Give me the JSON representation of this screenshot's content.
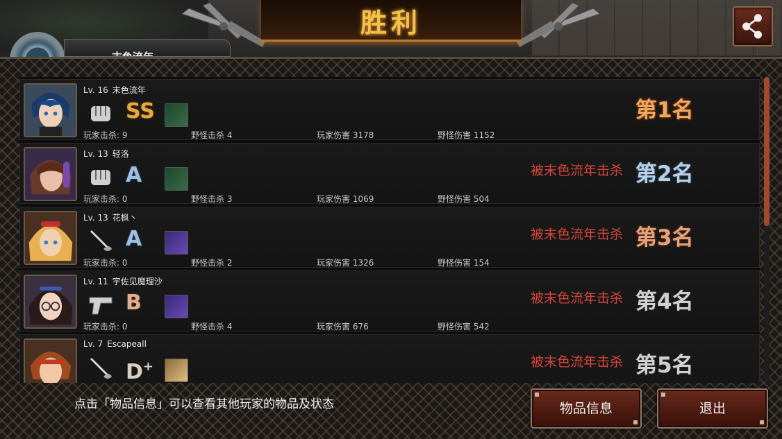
{
  "header": {
    "title": "胜利",
    "top_player_name_partial": "末色流年"
  },
  "players": [
    {
      "level": "Lv. 16",
      "name": "末色流年",
      "weapon": "fist-icon",
      "grade": "SS",
      "item": "zombie-item-icon",
      "player_kills": "玩家击杀: 9",
      "monster_kills": "野怪击杀 4",
      "player_damage": "玩家伤害 3178",
      "monster_damage": "野怪伤害 1152",
      "killed_by": "",
      "rank": "第1名"
    },
    {
      "level": "Lv. 13",
      "name": "轻洛",
      "weapon": "fist-icon",
      "grade": "A",
      "item": "zombie-item-icon",
      "player_kills": "玩家击杀: 0",
      "monster_kills": "野怪击杀 3",
      "player_damage": "玩家伤害 1069",
      "monster_damage": "野怪伤害 504",
      "killed_by": "被末色流年击杀",
      "rank": "第2名"
    },
    {
      "level": "Lv. 13",
      "name": "花枫丶",
      "weapon": "rapier-icon",
      "grade": "A",
      "item": "purple-item-icon",
      "player_kills": "玩家击杀: 0",
      "monster_kills": "野怪击杀 2",
      "player_damage": "玩家伤害 1326",
      "monster_damage": "野怪伤害 154",
      "killed_by": "被末色流年击杀",
      "rank": "第3名"
    },
    {
      "level": "Lv. 11",
      "name": "宇佐见魔理沙",
      "weapon": "pistol-icon",
      "grade": "B",
      "item": "purple-item-icon",
      "player_kills": "玩家击杀: 0",
      "monster_kills": "野怪击杀 4",
      "player_damage": "玩家伤害 676",
      "monster_damage": "野怪伤害 542",
      "killed_by": "被末色流年击杀",
      "rank": "第4名"
    },
    {
      "level": "Lv. 7",
      "name": "Escapeall",
      "weapon": "rapier-icon",
      "grade": "D",
      "grade_suffix": "+",
      "item": "gold-item-icon",
      "player_kills": "",
      "monster_kills": "",
      "player_damage": "",
      "monster_damage": "",
      "killed_by": "被末色流年击杀",
      "rank": "第5名"
    }
  ],
  "footer": {
    "hint": "点击「物品信息」可以查看其他玩家的物品及状态",
    "items_button": "物品信息",
    "exit_button": "退出"
  },
  "colors": {
    "accent_gold": "#f2c24a",
    "killed_red": "#d8463a",
    "button_red": "#6a2a1e"
  }
}
